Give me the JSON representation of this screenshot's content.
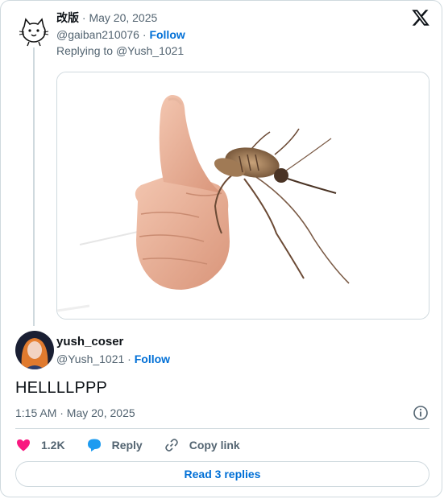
{
  "parent_tweet": {
    "author_name": "改版",
    "date": "May 20, 2025",
    "separator": " · ",
    "handle": "@gaiban210076",
    "follow_label": "Follow",
    "replying_prefix": "Replying to ",
    "replying_to": "@Yush_1021"
  },
  "main_tweet": {
    "author_name": "yush_coser",
    "handle": "@Yush_1021",
    "separator": " · ",
    "follow_label": "Follow",
    "text": "HELLLLPPP",
    "timestamp": "1:15 AM · May 20, 2025"
  },
  "actions": {
    "like_count": "1.2K",
    "reply_label": "Reply",
    "copy_link_label": "Copy link",
    "read_replies_label": "Read 3 replies"
  },
  "icons": {
    "brand": "x-logo-icon",
    "like": "heart-icon",
    "reply": "speech-bubble-icon",
    "copy": "link-icon",
    "info": "info-icon"
  },
  "colors": {
    "link": "#006fd6",
    "like": "#f91880",
    "reply": "#1d9bf0",
    "muted": "#536471",
    "border": "#cfd9de"
  }
}
